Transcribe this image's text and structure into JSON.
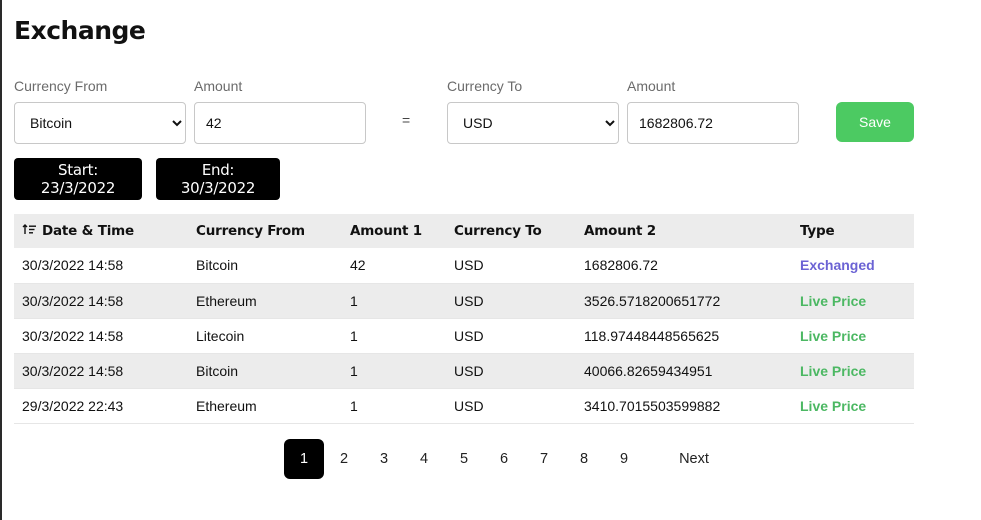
{
  "title": "Exchange",
  "form": {
    "currency_from_label": "Currency From",
    "amount1_label": "Amount",
    "currency_to_label": "Currency To",
    "amount2_label": "Amount",
    "currency_from_value": "Bitcoin",
    "amount1_value": "42",
    "equals": "=",
    "currency_to_value": "USD",
    "amount2_value": "1682806.72",
    "save_label": "Save"
  },
  "filters": {
    "start_label": "Start: 23/3/2022",
    "end_label": "End: 30/3/2022"
  },
  "table": {
    "headers": [
      "Date & Time",
      "Currency From",
      "Amount 1",
      "Currency To",
      "Amount 2",
      "Type"
    ],
    "rows": [
      {
        "date": "30/3/2022 14:58",
        "from": "Bitcoin",
        "amount1": "42",
        "to": "USD",
        "amount2": "1682806.72",
        "type": "Exchanged"
      },
      {
        "date": "30/3/2022 14:58",
        "from": "Ethereum",
        "amount1": "1",
        "to": "USD",
        "amount2": "3526.5718200651772",
        "type": "Live Price"
      },
      {
        "date": "30/3/2022 14:58",
        "from": "Litecoin",
        "amount1": "1",
        "to": "USD",
        "amount2": "118.97448448565625",
        "type": "Live Price"
      },
      {
        "date": "30/3/2022 14:58",
        "from": "Bitcoin",
        "amount1": "1",
        "to": "USD",
        "amount2": "40066.82659434951",
        "type": "Live Price"
      },
      {
        "date": "29/3/2022 22:43",
        "from": "Ethereum",
        "amount1": "1",
        "to": "USD",
        "amount2": "3410.7015503599882",
        "type": "Live Price"
      }
    ]
  },
  "pagination": {
    "pages": [
      "1",
      "2",
      "3",
      "4",
      "5",
      "6",
      "7",
      "8",
      "9"
    ],
    "current": "1",
    "next_label": "Next"
  },
  "colors": {
    "save": "#4cca62",
    "exchanged": "#6b63d4",
    "live_price": "#4cb863",
    "stripe": "#ececec"
  },
  "icons": {
    "sort": "sort-ascending-icon"
  }
}
